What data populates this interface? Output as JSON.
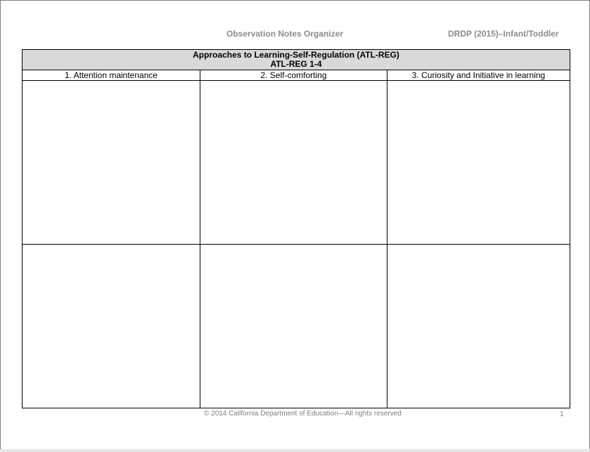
{
  "header": {
    "title": "Observation Notes Organizer",
    "instrument": "DRDP (2015)–Infant/Toddler"
  },
  "table": {
    "title_line1": "Approaches to Learning-Self-Regulation (ATL-REG)",
    "title_line2": "ATL-REG 1-4",
    "columns": [
      {
        "label": "1.  Attention maintenance"
      },
      {
        "label": "2.  Self-comforting"
      },
      {
        "label": "3.  Curiosity and Initiative in learning"
      }
    ],
    "rows": [
      [
        "",
        "",
        ""
      ],
      [
        "",
        "",
        ""
      ]
    ]
  },
  "footer": {
    "copyright": "© 2014 California Department of Education—All rights reserved",
    "page_number": "1"
  }
}
